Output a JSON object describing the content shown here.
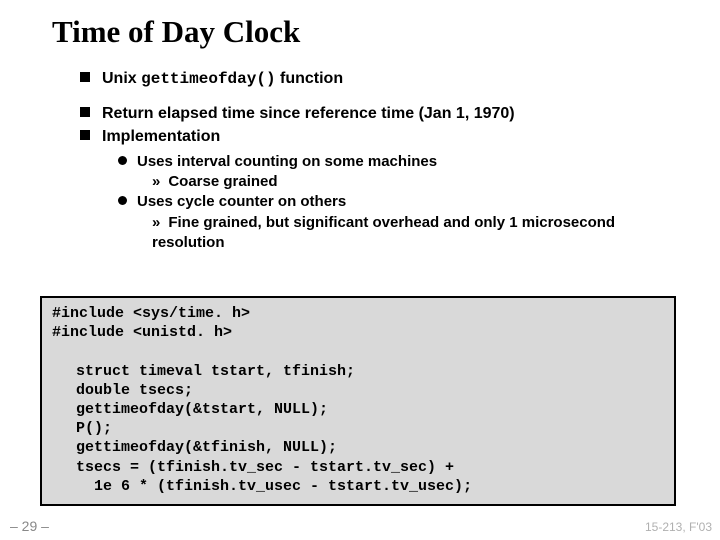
{
  "title": "Time of Day Clock",
  "bullets": {
    "b1_pre": "Unix ",
    "b1_mono": "gettimeofday()",
    "b1_post": " function",
    "b2": "Return elapsed time since reference time (Jan 1, 1970)",
    "b3": "Implementation",
    "s1": "Uses interval counting on some machines",
    "s1a": "Coarse grained",
    "s2": "Uses cycle counter on others",
    "s2a": "Fine grained, but significant overhead and only 1 microsecond resolution"
  },
  "code": {
    "l1": "#include <sys/time. h>",
    "l2": "#include <unistd. h>",
    "l3": "struct timeval tstart, tfinish;",
    "l4": "double tsecs;",
    "l5": "gettimeofday(&tstart, NULL);",
    "l6": "P();",
    "l7": "gettimeofday(&tfinish, NULL);",
    "l8": "tsecs = (tfinish.tv_sec - tstart.tv_sec) +",
    "l9": "  1e 6 * (tfinish.tv_usec - tstart.tv_usec);"
  },
  "page": "– 29 –",
  "footer_right": "15-213, F'03"
}
